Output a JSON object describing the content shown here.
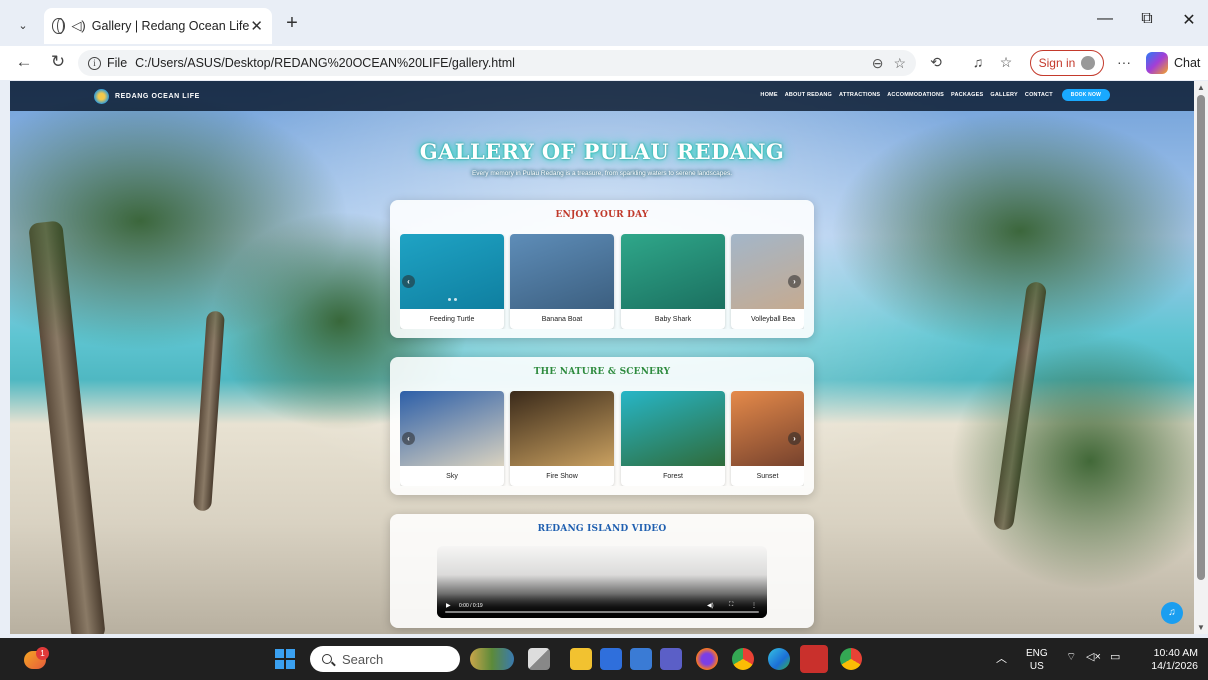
{
  "browser": {
    "tab_title": "Gallery | Redang Ocean Life",
    "tab_close": "✕",
    "new_tab": "+",
    "scheme": "File",
    "url": "C:/Users/ASUS/Desktop/REDANG%20OCEAN%20LIFE/gallery.html",
    "sign_in": "Sign in",
    "chat": "Chat",
    "more": "···"
  },
  "site": {
    "brand": "REDANG OCEAN LIFE",
    "nav": [
      "HOME",
      "ABOUT REDANG",
      "ATTRACTIONS",
      "ACCOMMODATIONS",
      "PACKAGES",
      "GALLERY",
      "CONTACT"
    ],
    "book_now": "BOOK NOW",
    "hero_title": "GALLERY OF PULAU REDANG",
    "hero_subtitle": "Every memory in Pulau Redang is a treasure, from sparkling waters to serene landscapes."
  },
  "sections": [
    {
      "title": "ENJOY YOUR DAY",
      "title_color": "#c0392b",
      "items": [
        {
          "caption": "Feeding Turtle",
          "colors": [
            "#1fa3c4",
            "#0f7fa0"
          ]
        },
        {
          "caption": "Banana Boat",
          "colors": [
            "#5e8db8",
            "#3c5f80"
          ]
        },
        {
          "caption": "Baby Shark",
          "colors": [
            "#2fa78a",
            "#1b7060"
          ]
        },
        {
          "caption": "Volleyball Bea",
          "colors": [
            "#a3b6c9",
            "#c9a98a"
          ]
        }
      ]
    },
    {
      "title": "THE NATURE & SCENERY",
      "title_color": "#2e8b3e",
      "items": [
        {
          "caption": "Sky",
          "colors": [
            "#2d5fa8",
            "#d9d2c0"
          ]
        },
        {
          "caption": "Fire Show",
          "colors": [
            "#3a2a1a",
            "#c9a060"
          ]
        },
        {
          "caption": "Forest",
          "colors": [
            "#27b6c7",
            "#2f6b3a"
          ]
        },
        {
          "caption": "Sunset",
          "colors": [
            "#e58a4a",
            "#6a3a2a"
          ]
        }
      ]
    }
  ],
  "video": {
    "title": "REDANG ISLAND VIDEO",
    "title_color": "#1f5fb0",
    "time": "0:00 / 0:19"
  },
  "taskbar": {
    "weather_badge": "1",
    "search": "Search",
    "lang_top": "ENG",
    "lang_bottom": "US",
    "time": "10:40 AM",
    "date": "14/1/2026"
  }
}
